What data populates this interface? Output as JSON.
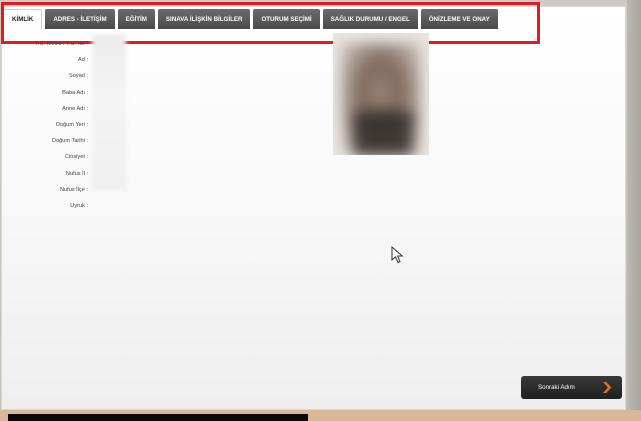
{
  "tabs": [
    {
      "label": "KİMLİK",
      "active": true
    },
    {
      "label": "ADRES - İLETİŞİM"
    },
    {
      "label": "EĞİTİM"
    },
    {
      "label": "SINAVA İLİŞKİN BİLGİLER"
    },
    {
      "label": "OTURUM SEÇİMİ"
    },
    {
      "label": "SAĞLIK DURUMU / ENGEL"
    },
    {
      "label": "ÖNİZLEME VE ONAY"
    }
  ],
  "form": {
    "labels": [
      "T.C. Kimlik / Y.U. No :",
      "Ad :",
      "Soyad :",
      "Baba Adı :",
      "Anne Adı :",
      "Doğum Yeri :",
      "Doğum Tarihi :",
      "Cinsiyet :",
      "Nufus İl :",
      "Nufus İlçe :",
      "Uyruk :"
    ]
  },
  "footer": {
    "next_label": "Sonraki Adım"
  },
  "colors": {
    "highlight": "#e11b22",
    "tab_bg": "#555555",
    "arrow": "#e8752a"
  }
}
